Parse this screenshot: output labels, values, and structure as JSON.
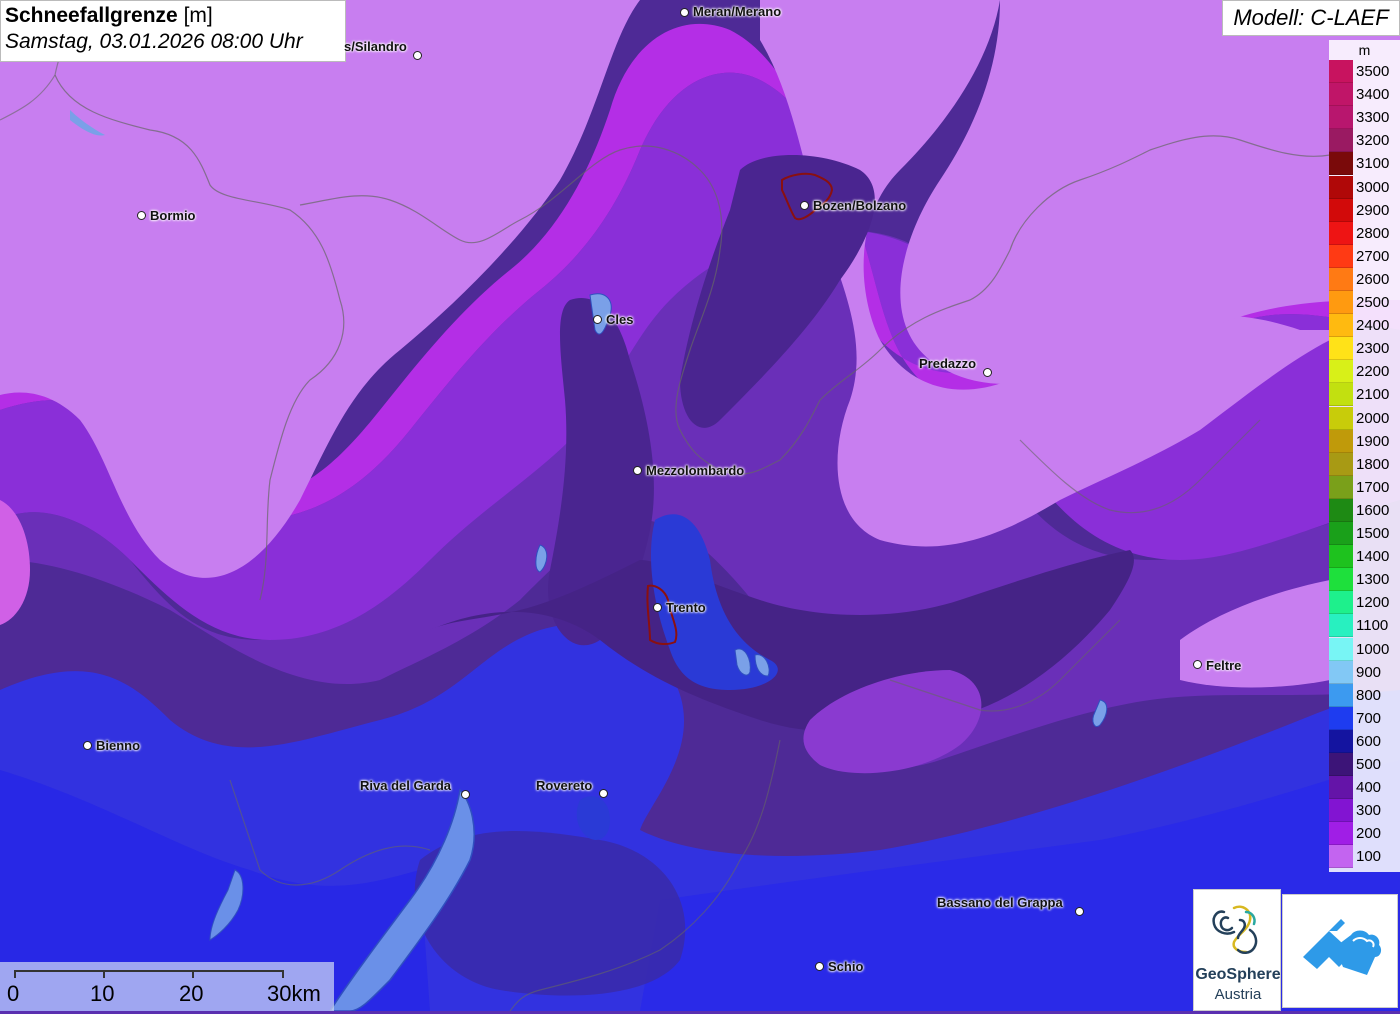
{
  "title": {
    "main": "Schneefallgrenze",
    "unit": "[m]",
    "datetime": "Samstag, 03.01.2026 08:00 Uhr"
  },
  "model": "Modell: C-LAEF",
  "legend": {
    "unit": "m",
    "entries": [
      {
        "label": "3500",
        "color": "#c8135f"
      },
      {
        "label": "3400",
        "color": "#c01568"
      },
      {
        "label": "3300",
        "color": "#b8166e"
      },
      {
        "label": "3200",
        "color": "#9a1a62"
      },
      {
        "label": "3100",
        "color": "#7a0a0a"
      },
      {
        "label": "3000",
        "color": "#b00808"
      },
      {
        "label": "2900",
        "color": "#d20a0a"
      },
      {
        "label": "2800",
        "color": "#ee1414"
      },
      {
        "label": "2700",
        "color": "#ff3a14"
      },
      {
        "label": "2600",
        "color": "#ff7a14"
      },
      {
        "label": "2500",
        "color": "#ff9a10"
      },
      {
        "label": "2400",
        "color": "#ffba10"
      },
      {
        "label": "2300",
        "color": "#ffe218"
      },
      {
        "label": "2200",
        "color": "#d8f018"
      },
      {
        "label": "2100",
        "color": "#c2e010"
      },
      {
        "label": "2000",
        "color": "#c8cc0a"
      },
      {
        "label": "1900",
        "color": "#c09a0a"
      },
      {
        "label": "1800",
        "color": "#a89a14"
      },
      {
        "label": "1700",
        "color": "#7aa01a"
      },
      {
        "label": "1600",
        "color": "#1e8a14"
      },
      {
        "label": "1500",
        "color": "#1aa01a"
      },
      {
        "label": "1400",
        "color": "#1ec21e"
      },
      {
        "label": "1300",
        "color": "#1ee03c"
      },
      {
        "label": "1200",
        "color": "#1ef08c"
      },
      {
        "label": "1100",
        "color": "#28f0c0"
      },
      {
        "label": "1000",
        "color": "#78f5f5"
      },
      {
        "label": "900",
        "color": "#82c8f5"
      },
      {
        "label": "800",
        "color": "#3c9af0"
      },
      {
        "label": "700",
        "color": "#1e3cf0"
      },
      {
        "label": "600",
        "color": "#1414a0"
      },
      {
        "label": "500",
        "color": "#3c1478"
      },
      {
        "label": "400",
        "color": "#6414a8"
      },
      {
        "label": "300",
        "color": "#8214d2"
      },
      {
        "label": "200",
        "color": "#a01ee6"
      },
      {
        "label": "100",
        "color": "#c364f0"
      }
    ]
  },
  "cities": [
    {
      "name": "Meran/Merano",
      "dot": [
        684,
        12
      ],
      "label": [
        693,
        4
      ]
    },
    {
      "name": "s/Silandro",
      "dot": [
        417,
        55
      ],
      "label": [
        344,
        39
      ]
    },
    {
      "name": "Bormio",
      "dot": [
        141,
        215
      ],
      "label": [
        150,
        208
      ]
    },
    {
      "name": "Bozen/Bolzano",
      "dot": [
        804,
        205
      ],
      "label": [
        813,
        198
      ]
    },
    {
      "name": "Cles",
      "dot": [
        597,
        319
      ],
      "label": [
        606,
        312
      ]
    },
    {
      "name": "Predazzo",
      "dot": [
        987,
        372
      ],
      "label": [
        919,
        356
      ]
    },
    {
      "name": "Mezzolombardo",
      "dot": [
        637,
        470
      ],
      "label": [
        646,
        463
      ]
    },
    {
      "name": "Trento",
      "dot": [
        657,
        607
      ],
      "label": [
        666,
        600
      ]
    },
    {
      "name": "Feltre",
      "dot": [
        1197,
        664
      ],
      "label": [
        1206,
        658
      ]
    },
    {
      "name": "Bienno",
      "dot": [
        87,
        745
      ],
      "label": [
        96,
        738
      ]
    },
    {
      "name": "Riva del Garda",
      "dot": [
        465,
        794
      ],
      "label": [
        360,
        778
      ]
    },
    {
      "name": "Rovereto",
      "dot": [
        603,
        793
      ],
      "label": [
        536,
        778
      ]
    },
    {
      "name": "Bassano del Grappa",
      "dot": [
        1079,
        911
      ],
      "label": [
        937,
        895
      ]
    },
    {
      "name": "Schio",
      "dot": [
        819,
        966
      ],
      "label": [
        828,
        959
      ]
    }
  ],
  "scale_bar": {
    "labels": [
      "0",
      "10",
      "20",
      "30km"
    ]
  },
  "logos": {
    "geosphere_name": "GeoSphere",
    "geosphere_sub": "Austria"
  }
}
